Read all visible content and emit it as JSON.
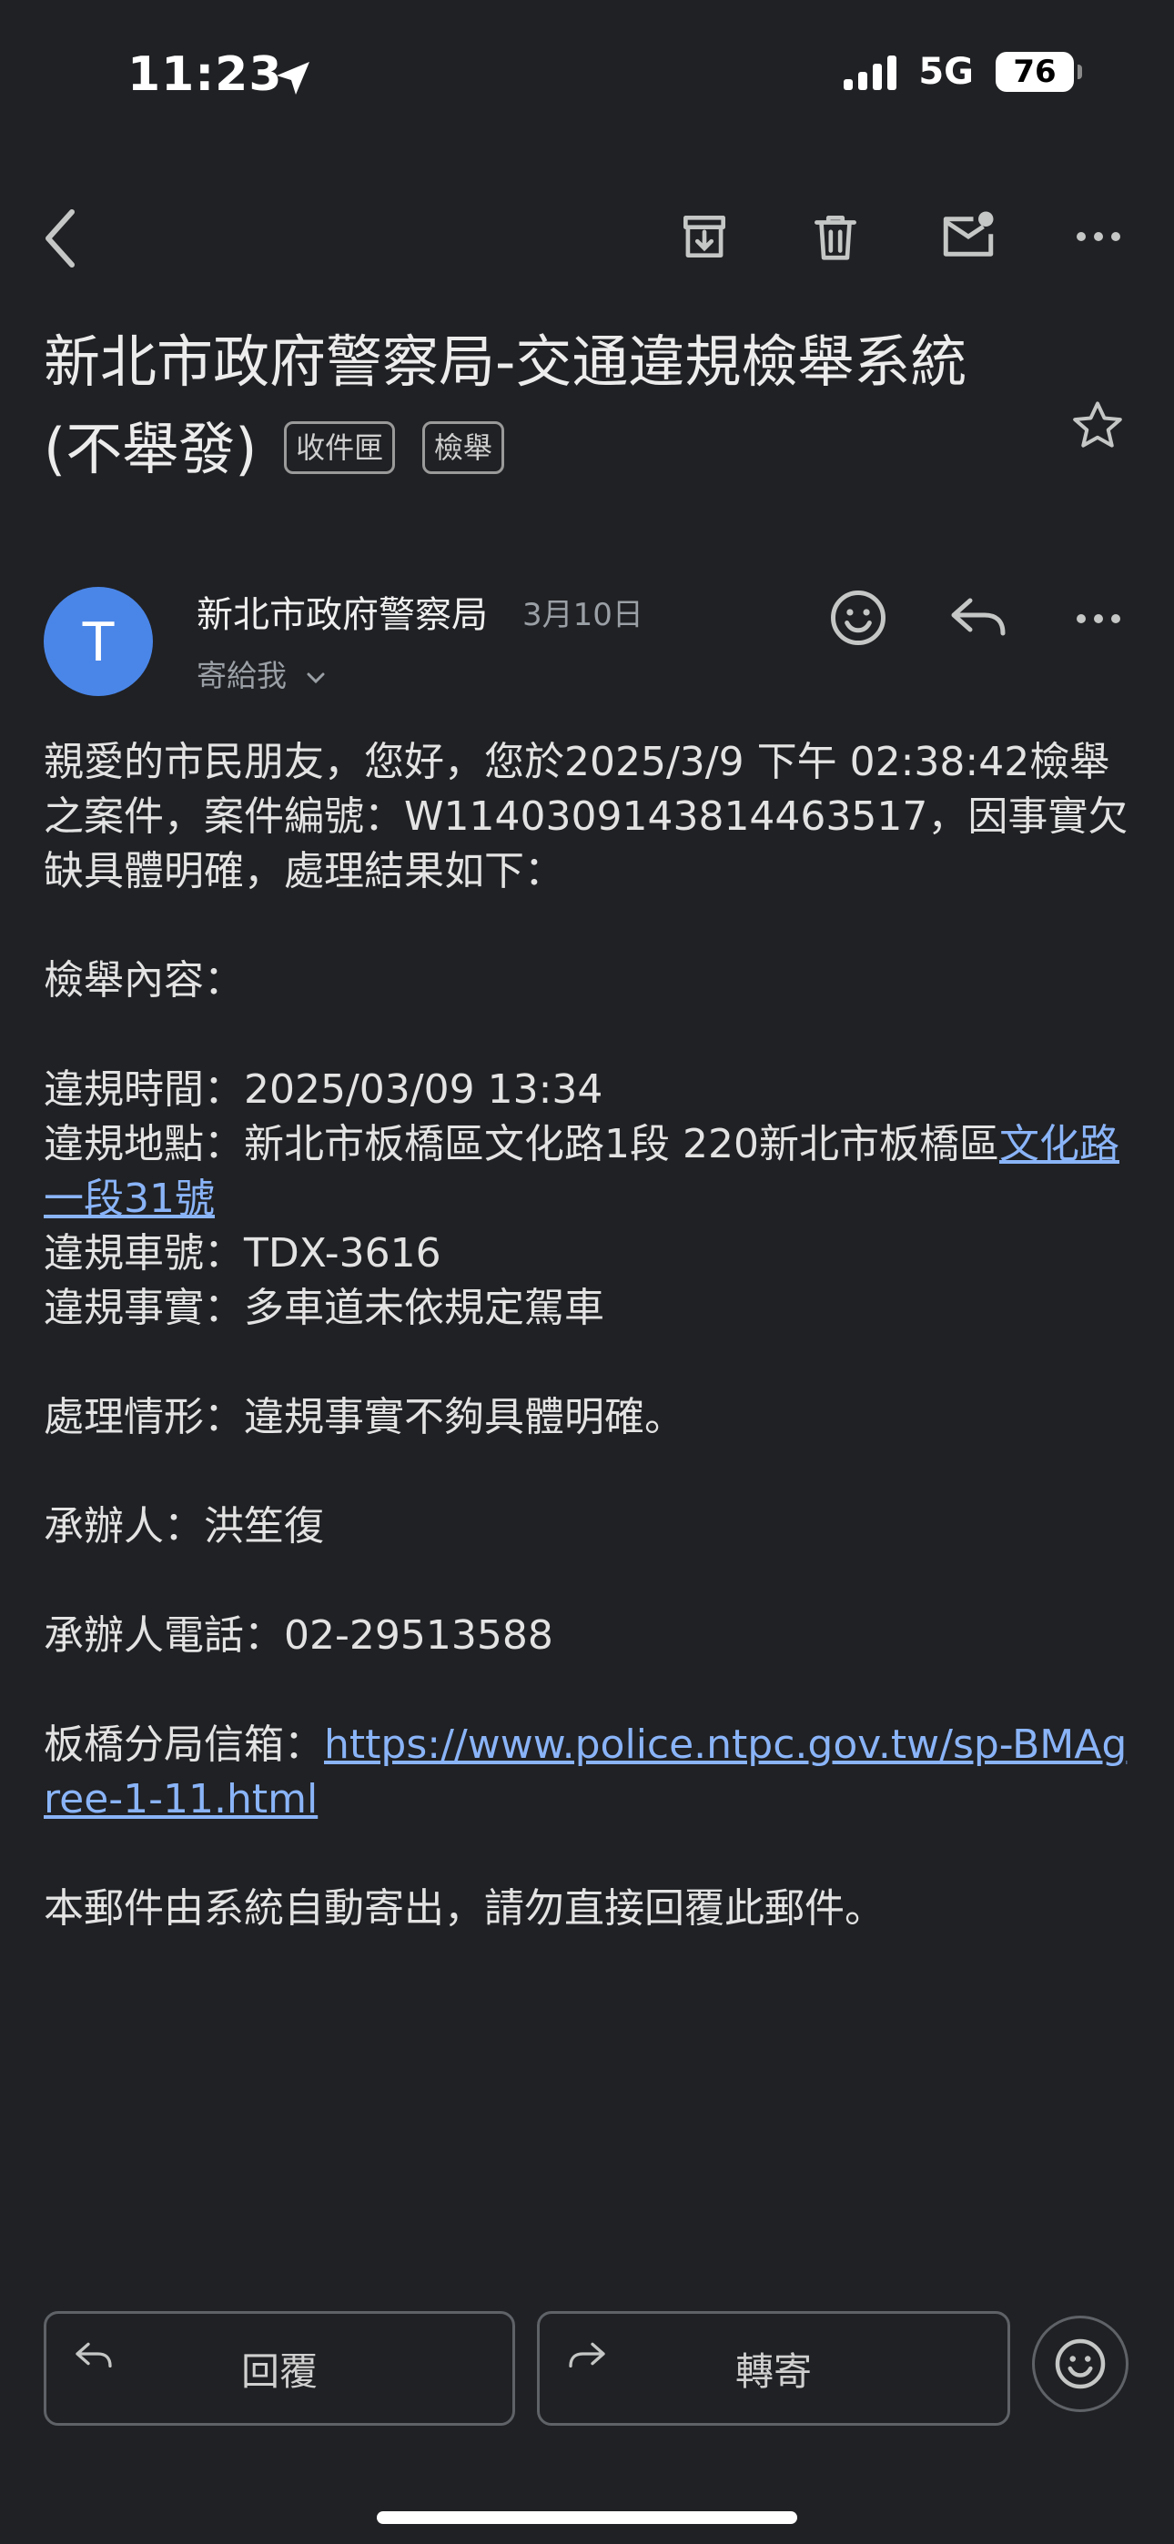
{
  "status_bar": {
    "time": "11:23",
    "network": "5G",
    "battery": "76"
  },
  "toolbar": {
    "icons": [
      "back-icon",
      "archive-icon",
      "trash-icon",
      "mark-unread-icon",
      "more-icon"
    ]
  },
  "email": {
    "subject": "新北市政府警察局-交通違規檢舉系統(不舉發)",
    "labels": [
      "收件匣",
      "檢舉"
    ],
    "sender": "新北市政府警察局",
    "avatar_letter": "T",
    "date": "3月10日",
    "to": "寄給我",
    "body": {
      "intro": "親愛的市民朋友，您好，您於2025/3/9 下午 02:38:42檢舉之案件，案件編號：W1140309143814463517，因事實欠缺具體明確，處理結果如下：",
      "section_title": "檢舉內容：",
      "time_line": "違規時間：2025/03/09 13:34",
      "location_prefix": "違規地點：新北市板橋區文化路1段 220新北市板橋區",
      "location_link": "文化路一段31號",
      "plate_line": "違規車號：TDX-3616",
      "fact_line": "違規事實：多車道未依規定駕車",
      "status_line": "處理情形：違規事實不夠具體明確。",
      "officer_line": "承辦人：洪笙復",
      "phone_line": "承辦人電話：02-29513588",
      "mailbox_prefix": "板橋分局信箱：",
      "mailbox_link": "https://www.police.ntpc.gov.tw/sp-BMAgree-1-11.html",
      "footer_line": "本郵件由系統自動寄出，請勿直接回覆此郵件。"
    }
  },
  "actions": {
    "reply": "回覆",
    "forward": "轉寄"
  }
}
